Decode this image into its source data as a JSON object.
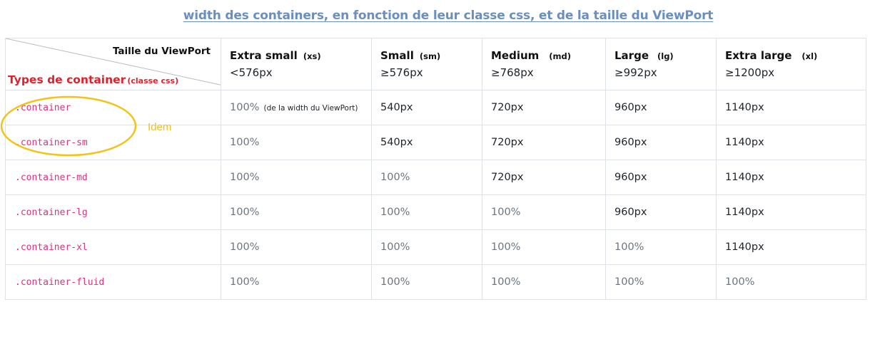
{
  "title": "width des containers, en fonction de leur classe css, et de la taille du ViewPort",
  "corner": {
    "viewport_label": "Taille du ViewPort",
    "types_label": "Types de container",
    "types_sub": "(classe css)"
  },
  "columns": [
    {
      "name": "Extra small",
      "abbr": "(xs)",
      "range": "<576px"
    },
    {
      "name": "Small",
      "abbr": "(sm)",
      "range": "≥576px"
    },
    {
      "name": "Medium",
      "abbr": "(md)",
      "range": "≥768px"
    },
    {
      "name": "Large",
      "abbr": "(lg)",
      "range": "≥992px"
    },
    {
      "name": "Extra large",
      "abbr": "(xl)",
      "range": "≥1200px"
    }
  ],
  "rows": [
    {
      "class": ".container",
      "values": [
        "100%",
        "540px",
        "720px",
        "960px",
        "1140px"
      ],
      "note": "(de la width du ViewPort)"
    },
    {
      "class": ".container-sm",
      "values": [
        "100%",
        "540px",
        "720px",
        "960px",
        "1140px"
      ]
    },
    {
      "class": ".container-md",
      "values": [
        "100%",
        "100%",
        "720px",
        "960px",
        "1140px"
      ]
    },
    {
      "class": ".container-lg",
      "values": [
        "100%",
        "100%",
        "100%",
        "960px",
        "1140px"
      ]
    },
    {
      "class": ".container-xl",
      "values": [
        "100%",
        "100%",
        "100%",
        "100%",
        "1140px"
      ]
    },
    {
      "class": ".container-fluid",
      "values": [
        "100%",
        "100%",
        "100%",
        "100%",
        "100%"
      ]
    }
  ],
  "annotation": {
    "label": "Idem",
    "color": "#f0c020"
  },
  "colors": {
    "title": "#6b8ec0",
    "class_name": "#d63384",
    "types_label": "#e0202a",
    "muted_value": "#6c757d"
  }
}
